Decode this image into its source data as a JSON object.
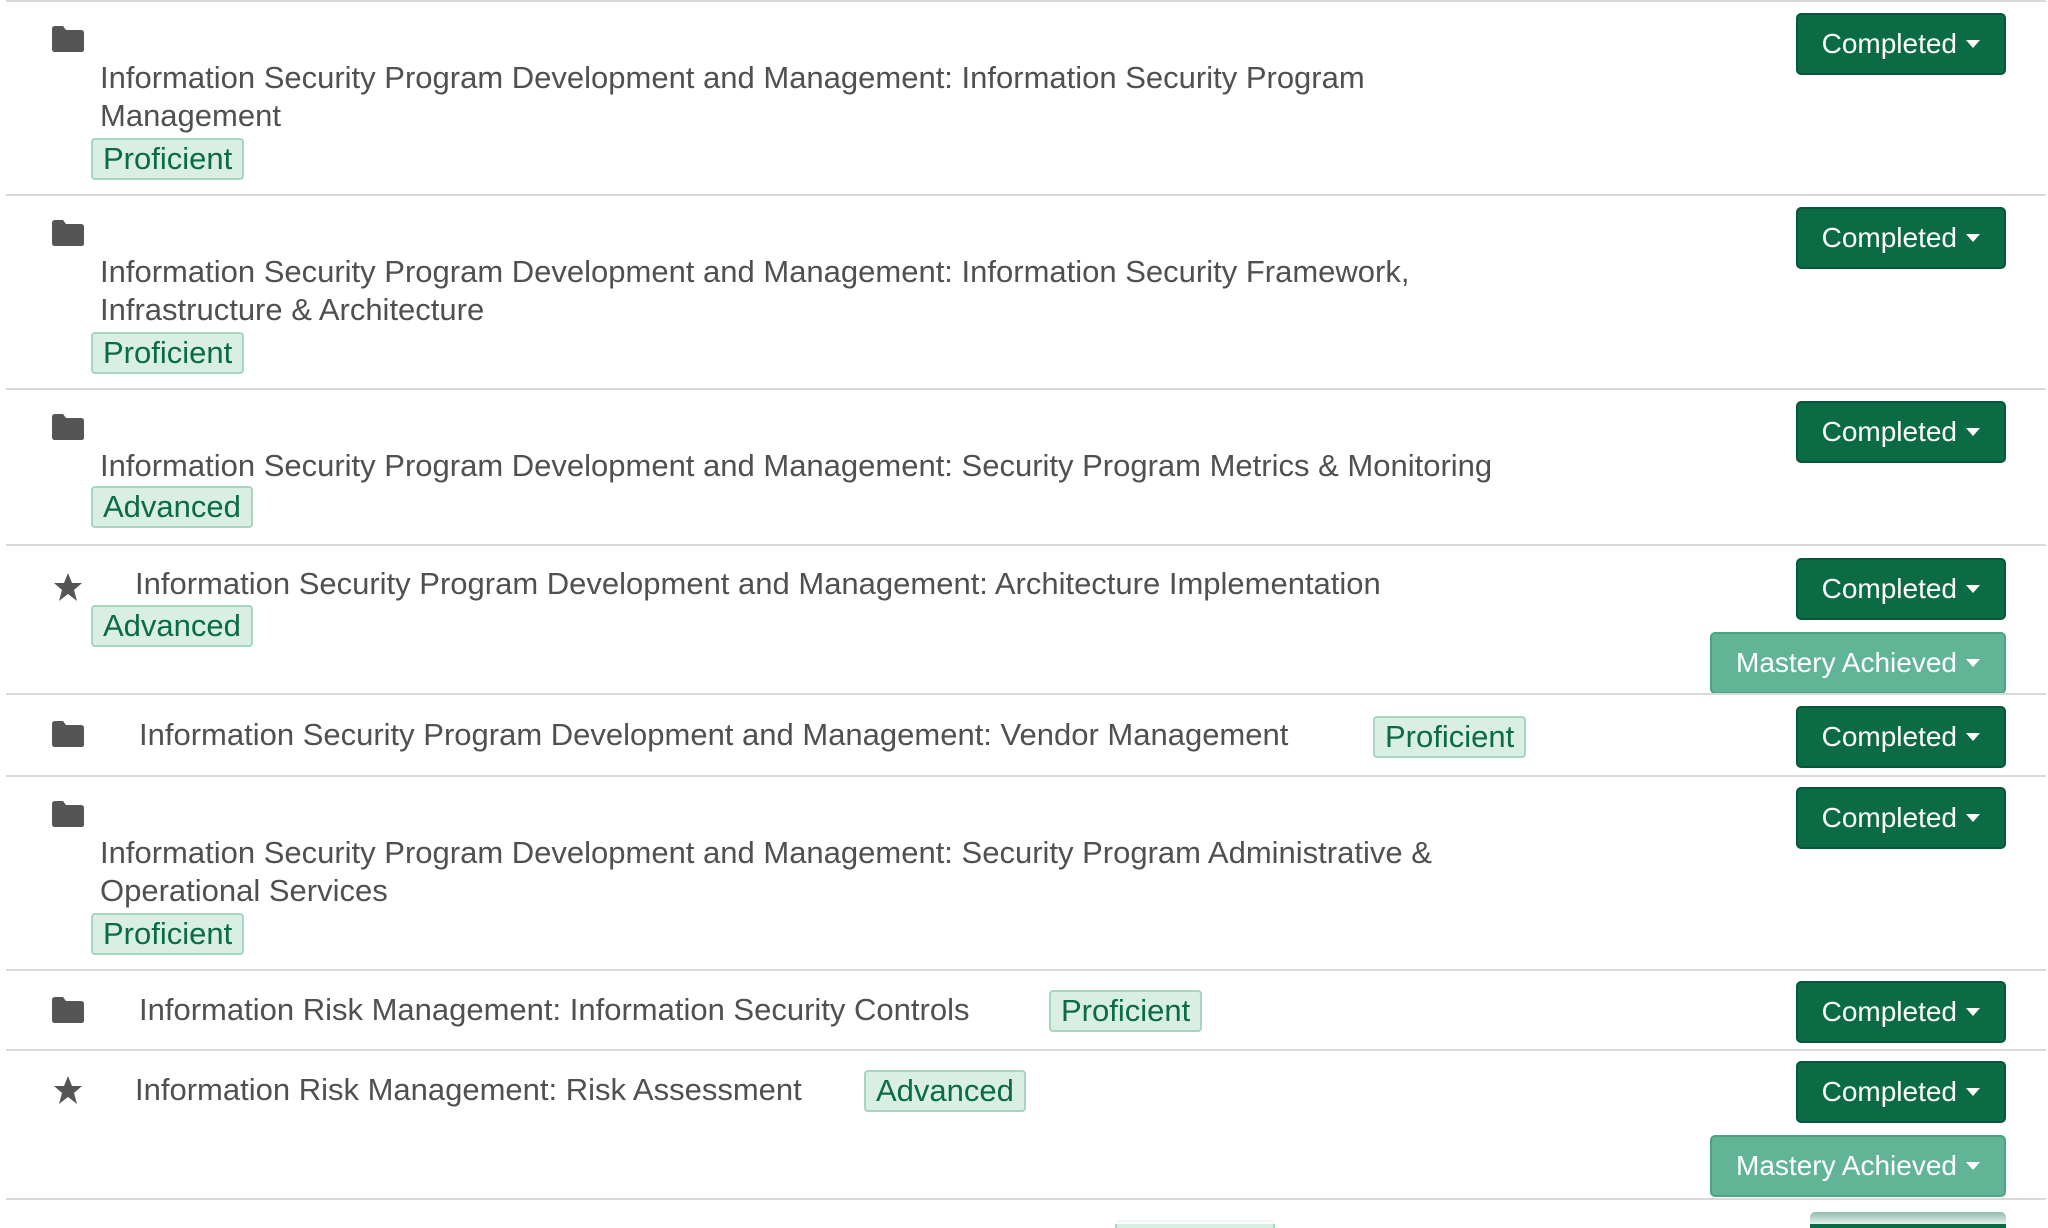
{
  "items": [
    {
      "icon": "folder-icon",
      "title": "Information Security Program Development and Management: Information Security Program Management",
      "level": "Proficient",
      "status": "Completed"
    },
    {
      "icon": "folder-icon",
      "title": "Information Security Program Development and Management: Information Security Framework, Infrastructure & Architecture",
      "level": "Proficient",
      "status": "Completed"
    },
    {
      "icon": "folder-icon",
      "title": "Information Security Program Development and Management: Security Program Metrics & Monitoring",
      "level": "Advanced",
      "status": "Completed"
    },
    {
      "icon": "star-icon",
      "title": "Information Security Program Development and Management: Architecture Implementation",
      "level": "Advanced",
      "status": "Completed",
      "mastery": "Mastery Achieved"
    },
    {
      "icon": "folder-icon",
      "title": "Information Security Program Development and Management: Vendor Management",
      "level": "Proficient",
      "status": "Completed"
    },
    {
      "icon": "folder-icon",
      "title": "Information Security Program Development and Management: Security Program Administrative & Operational Services",
      "level": "Proficient",
      "status": "Completed"
    },
    {
      "icon": "folder-icon",
      "title": "Information Risk Management: Information Security Controls",
      "level": "Proficient",
      "status": "Completed"
    },
    {
      "icon": "star-icon",
      "title": "Information Risk Management: Risk Assessment",
      "level": "Advanced",
      "status": "Completed",
      "mastery": "Mastery Achieved"
    }
  ],
  "colors": {
    "button_primary": "#0a6b45",
    "button_mastery": "#61b596",
    "badge_background": "#d9efe4",
    "badge_text": "#0a6b45",
    "icon": "#555555",
    "divider": "#d9d9d9"
  }
}
